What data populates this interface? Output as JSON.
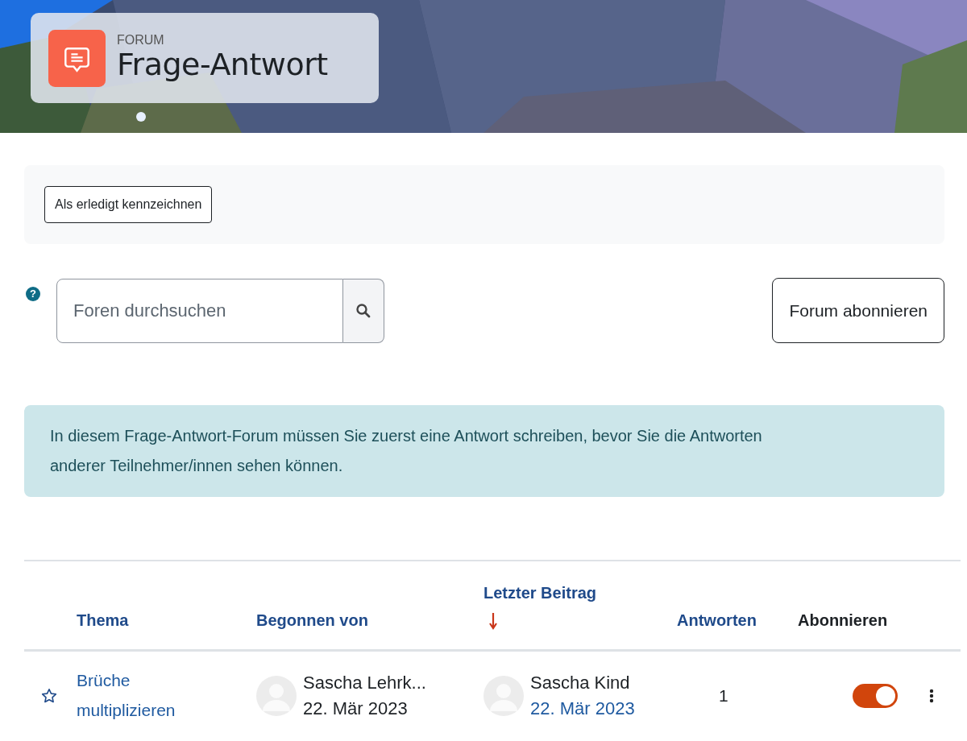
{
  "header": {
    "kicker": "FORUM",
    "title": "Frage-Antwort"
  },
  "completion_button": "Als erledigt kennzeichnen",
  "search": {
    "help": "?",
    "placeholder": "Foren durchsuchen"
  },
  "subscribe_button": "Forum abonnieren",
  "notice": "In diesem Frage-Antwort-Forum müssen Sie zuerst eine Antwort schreiben, bevor Sie die Antworten anderer Teilnehmer/innen sehen können.",
  "table": {
    "columns": [
      {
        "label": "Thema",
        "sortable": true,
        "sorted": false
      },
      {
        "label": "Begonnen von",
        "sortable": true,
        "sorted": false
      },
      {
        "label": "Letzter Beitrag",
        "sortable": true,
        "sorted": true
      },
      {
        "label": "Antworten",
        "sortable": true,
        "sorted": false
      },
      {
        "label": "Abonnieren",
        "sortable": false
      }
    ],
    "rows": [
      {
        "starred": false,
        "topic": "Brüche multiplizieren",
        "started_by": "Sascha Lehrk...",
        "started_date": "22. Mär 2023",
        "last_by": "Sascha Kind",
        "last_date": "22. Mär 2023",
        "replies": "1",
        "subscribed": true
      }
    ]
  }
}
